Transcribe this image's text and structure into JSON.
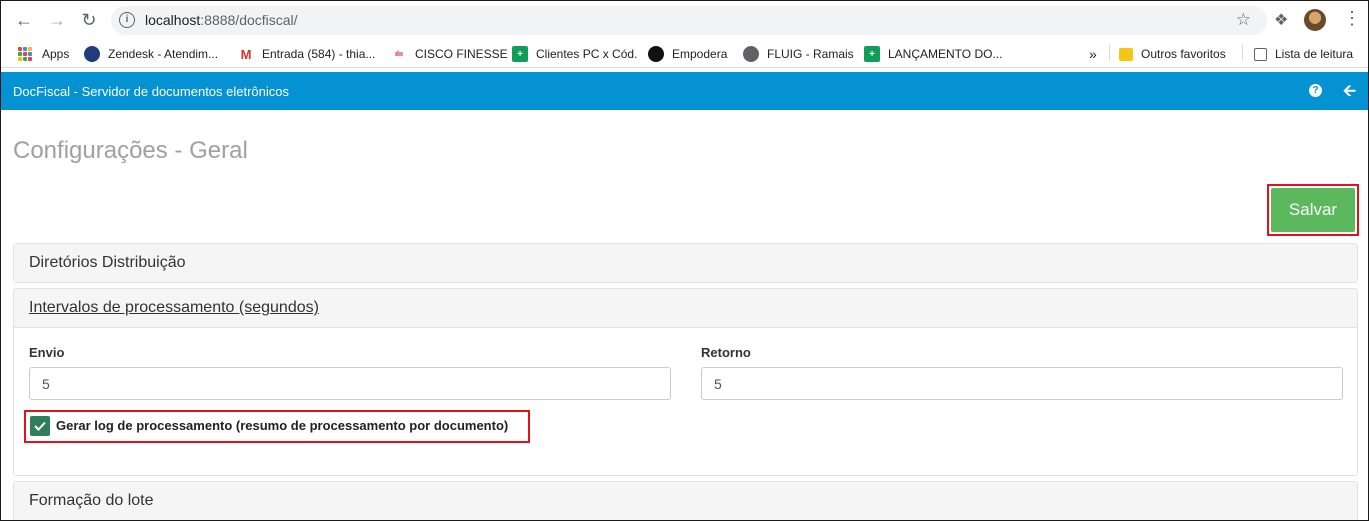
{
  "browser": {
    "url_host": "localhost",
    "url_port_path": ":8888/docfiscal/",
    "bookmarks": [
      {
        "label": "Apps",
        "icon": "apps-grid-icon"
      },
      {
        "label": "Zendesk - Atendim...",
        "icon": "zendesk-icon"
      },
      {
        "label": "Entrada (584) - thia...",
        "icon": "gmail-icon"
      },
      {
        "label": "CISCO FINESSE",
        "icon": "cisco-icon"
      },
      {
        "label": "Clientes PC x Cód.",
        "icon": "sheets-icon"
      },
      {
        "label": "Empodera",
        "icon": "empodera-icon"
      },
      {
        "label": "FLUIG - Ramais",
        "icon": "globe-icon"
      },
      {
        "label": "LANÇAMENTO DO...",
        "icon": "sheets-icon"
      }
    ],
    "more_bookmarks": "»",
    "other_favorites": "Outros favoritos",
    "reading_list": "Lista de leitura"
  },
  "app": {
    "title": "DocFiscal - Servidor de documentos eletrônicos",
    "help_icon": "help-icon",
    "back_icon": "arrow-left-icon"
  },
  "page": {
    "title": "Configurações - Geral",
    "save_label": "Salvar",
    "sections": {
      "distribution": "Diretórios Distribuição",
      "intervals": "Intervalos de processamento (segundos)",
      "batch": "Formação do lote"
    },
    "fields": {
      "envio_label": "Envio",
      "envio_value": "5",
      "retorno_label": "Retorno",
      "retorno_value": "5"
    },
    "checkbox": {
      "label": "Gerar log de processamento (resumo de processamento por documento)",
      "checked": true
    }
  },
  "colors": {
    "header": "#0592d3",
    "save": "#5cb85c",
    "highlight": "#e0121b",
    "checkbox": "#2e7d5b"
  }
}
